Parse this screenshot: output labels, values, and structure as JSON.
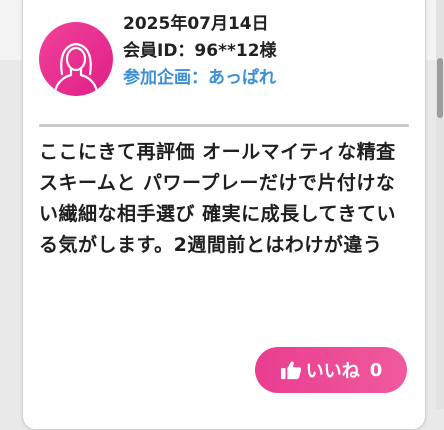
{
  "review": {
    "date": "2025年07月14日",
    "member_id": "会員ID：96**12様",
    "event": "参加企画：あっぱれ",
    "comment": "ここにきて再評価 オールマイティな精査スキームと パワープレーだけで片付けない繊細な相手選び 確実に成長してきている気がします。2週間前とはわけが違う",
    "avatar_icon": "female-user-icon"
  },
  "like_button": {
    "label": "いいね",
    "count": "0",
    "icon": "thumbs-up-icon"
  },
  "colors": {
    "accent_pink": "#ea3d90",
    "event_blue": "#3d8fd6"
  }
}
